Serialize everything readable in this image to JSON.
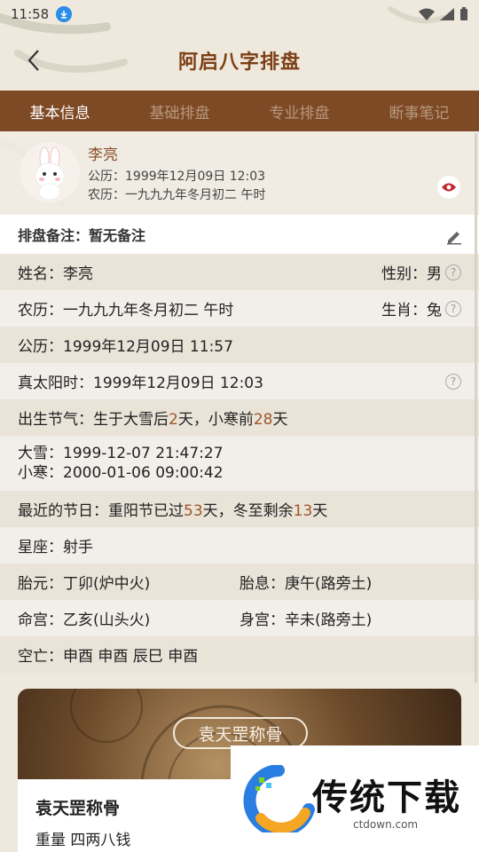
{
  "status_bar": {
    "time": "11:58"
  },
  "header": {
    "title": "阿启八字排盘",
    "back_icon": "chevron-left-icon"
  },
  "tabs": [
    {
      "label": "基本信息",
      "active": true
    },
    {
      "label": "基础排盘",
      "active": false
    },
    {
      "label": "专业排盘",
      "active": false
    },
    {
      "label": "断事笔记",
      "active": false
    }
  ],
  "profile": {
    "name": "李亮",
    "gregorian": "公历：1999年12月09日 12:03",
    "lunar": "农历：一九九九年冬月初二 午时"
  },
  "note": {
    "label": "排盘备注：暂无备注"
  },
  "info": {
    "name": "姓名：李亮",
    "gender": "性别：男",
    "lunar": "农历：一九九九年冬月初二 午时",
    "zodiac": "生肖：兔",
    "gregorian": "公历：1999年12月09日 11:57",
    "solar_time": "真太阳时：1999年12月09日 12:03",
    "solar_term_prefix": "出生节气：生于大雪后",
    "solar_term_days_after": "2",
    "solar_term_mid": "天，小寒前",
    "solar_term_days_before": "28",
    "solar_term_suffix": "天",
    "daxue": "大雪：1999-12-07 21:47:27",
    "xiaohan": "小寒：2000-01-06 09:00:42",
    "festival_prefix": "最近的节日：重阳节已过",
    "festival_days_passed": "53",
    "festival_mid": "天，冬至剩余",
    "festival_days_left": "13",
    "festival_suffix": "天",
    "constellation": "星座：射手",
    "taiyuan": "胎元：丁卯(炉中火)",
    "taixi": "胎息：庚午(路旁土)",
    "minggong": "命宫：乙亥(山头火)",
    "shengong": "身宫：辛未(路旁土)",
    "kongwang": "空亡：申酉 申酉 辰巳 申酉"
  },
  "bone_card": {
    "banner_label": "袁天罡称骨",
    "title": "袁天罡称骨",
    "weight": "重量  四两八钱"
  },
  "watermark": {
    "brand": "传统下载",
    "url": "ctdown.com"
  },
  "colors": {
    "accent": "#7b3f16",
    "tab_bg": "#7e4a26",
    "highlight": "#a0562a",
    "eye": "#c0262d"
  }
}
